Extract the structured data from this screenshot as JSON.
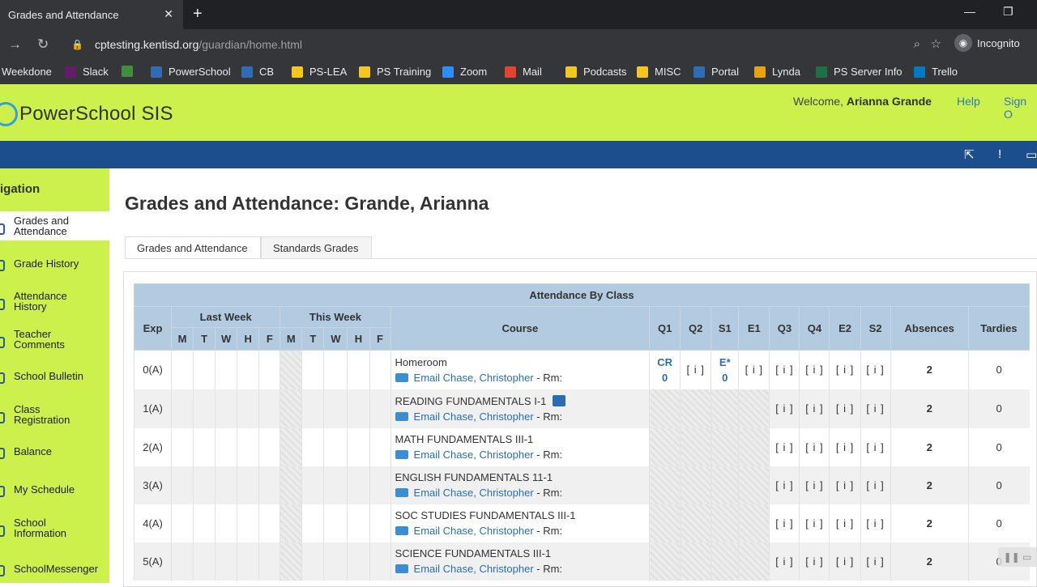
{
  "browser": {
    "tab_title": "Grades and Attendance",
    "url_domain": "cptesting.kentisd.org",
    "url_path": "/guardian/home.html",
    "profile": "Incognito",
    "bookmarks": [
      {
        "label": "Weekdone",
        "color": "#35363a"
      },
      {
        "label": "Slack",
        "color": "#611f69"
      },
      {
        "label": "",
        "color": "#3f8f3f"
      },
      {
        "label": "PowerSchool",
        "color": "#2e6db4"
      },
      {
        "label": "CB",
        "color": "#2e6db4"
      },
      {
        "label": "PS-LEA",
        "color": "#f3c623"
      },
      {
        "label": "PS Training",
        "color": "#f3c623"
      },
      {
        "label": "Zoom",
        "color": "#2d8cff"
      },
      {
        "label": "Mail",
        "color": "#e2442f"
      },
      {
        "label": "Podcasts",
        "color": "#f3c623"
      },
      {
        "label": "MISC",
        "color": "#f3c623"
      },
      {
        "label": "Portal",
        "color": "#2e6db4"
      },
      {
        "label": "Lynda",
        "color": "#e8a20c"
      },
      {
        "label": "PS Server Info",
        "color": "#1e7145"
      },
      {
        "label": "Trello",
        "color": "#0079bf"
      }
    ]
  },
  "header": {
    "app_name": "PowerSchool SIS",
    "welcome_prefix": "Welcome,",
    "user_name": "Arianna Grande",
    "help": "Help",
    "sign_out": "Sign O"
  },
  "sidebar": {
    "heading": "igation",
    "items": [
      {
        "line1": "Grades and",
        "line2": "Attendance"
      },
      {
        "line1": "Grade History",
        "line2": ""
      },
      {
        "line1": "Attendance",
        "line2": "History"
      },
      {
        "line1": "Teacher",
        "line2": "Comments"
      },
      {
        "line1": "School Bulletin",
        "line2": ""
      },
      {
        "line1": "Class",
        "line2": "Registration"
      },
      {
        "line1": "Balance",
        "line2": ""
      },
      {
        "line1": "My Schedule",
        "line2": ""
      },
      {
        "line1": "School",
        "line2": "Information"
      },
      {
        "line1": "SchoolMessenger",
        "line2": ""
      }
    ]
  },
  "main": {
    "title": "Grades and Attendance: Grande, Arianna",
    "tabs": [
      "Grades and Attendance",
      "Standards Grades"
    ],
    "table_caption": "Attendance By Class",
    "headers": {
      "exp": "Exp",
      "last_week": "Last Week",
      "this_week": "This Week",
      "days": [
        "M",
        "T",
        "W",
        "H",
        "F"
      ],
      "course": "Course",
      "terms": [
        "Q1",
        "Q2",
        "S1",
        "E1",
        "Q3",
        "Q4",
        "E2",
        "S2"
      ],
      "absences": "Absences",
      "tardies": "Tardies"
    },
    "rows": [
      {
        "exp": "0(A)",
        "course": "Homeroom",
        "teacher": "Email Chase, Christopher",
        "rm": " - Rm:",
        "q1a": "CR",
        "q1b": "0",
        "q2": "[ i ]",
        "s1a": "E*",
        "s1b": "0",
        "e1": "[ i ]",
        "q3": "[ i ]",
        "q4": "[ i ]",
        "e2": "[ i ]",
        "s2": "[ i ]",
        "absences": "2",
        "tardies": "0"
      },
      {
        "exp": "1(A)",
        "course": "READING FUNDAMENTALS I-1",
        "teacher": "Email Chase, Christopher",
        "rm": " - Rm:",
        "q3": "[ i ]",
        "q4": "[ i ]",
        "e2": "[ i ]",
        "s2": "[ i ]",
        "absences": "2",
        "tardies": "0"
      },
      {
        "exp": "2(A)",
        "course": "MATH FUNDAMENTALS III-1",
        "teacher": "Email Chase, Christopher",
        "rm": " - Rm:",
        "q3": "[ i ]",
        "q4": "[ i ]",
        "e2": "[ i ]",
        "s2": "[ i ]",
        "absences": "2",
        "tardies": "0"
      },
      {
        "exp": "3(A)",
        "course": "ENGLISH FUNDAMENTALS 11-1",
        "teacher": "Email Chase, Christopher",
        "rm": " - Rm:",
        "q3": "[ i ]",
        "q4": "[ i ]",
        "e2": "[ i ]",
        "s2": "[ i ]",
        "absences": "2",
        "tardies": "0"
      },
      {
        "exp": "4(A)",
        "course": "SOC STUDIES FUNDAMENTALS III-1",
        "teacher": "Email Chase, Christopher",
        "rm": " - Rm:",
        "q3": "[ i ]",
        "q4": "[ i ]",
        "e2": "[ i ]",
        "s2": "[ i ]",
        "absences": "2",
        "tardies": "0"
      },
      {
        "exp": "5(A)",
        "course": "SCIENCE FUNDAMENTALS III-1",
        "teacher": "Email Chase, Christopher",
        "rm": " - Rm:",
        "q3": "[ i ]",
        "q4": "[ i ]",
        "e2": "[ i ]",
        "s2": "[ i ]",
        "absences": "2",
        "tardies": "0"
      }
    ]
  }
}
